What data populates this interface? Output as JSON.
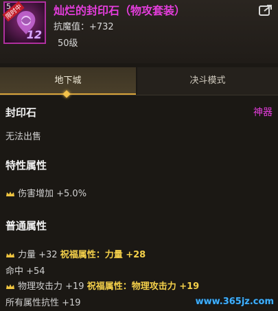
{
  "item": {
    "icon_level_prefix": "5",
    "icon_tag": "限时中",
    "icon_level": "12",
    "title": "灿烂的封印石（物攻套装）",
    "stat": "抗魔值：+732",
    "level": "50级"
  },
  "tabs": [
    {
      "label": "地下城",
      "active": true
    },
    {
      "label": "决斗模式",
      "active": false
    }
  ],
  "details": {
    "type_label": "封印石",
    "rarity_label": "神器",
    "trade_note": "无法出售",
    "trait_title": "特性属性",
    "trait_line": "伤害增加 +5.0%",
    "normal_title": "普通属性",
    "attr1_base": "力量 +32",
    "attr1_bless": "祝福属性：力量 +28",
    "attr2": "命中 +54",
    "attr3_base": "物理攻击力 +19",
    "attr3_bless": "祝福属性：物理攻击力 +19",
    "attr4": "所有属性抗性 +19"
  },
  "watermark": "www.365jz.com",
  "colors": {
    "title": "#e43ddc",
    "blessing": "#f4d04a",
    "accent": "#d9a43a"
  }
}
